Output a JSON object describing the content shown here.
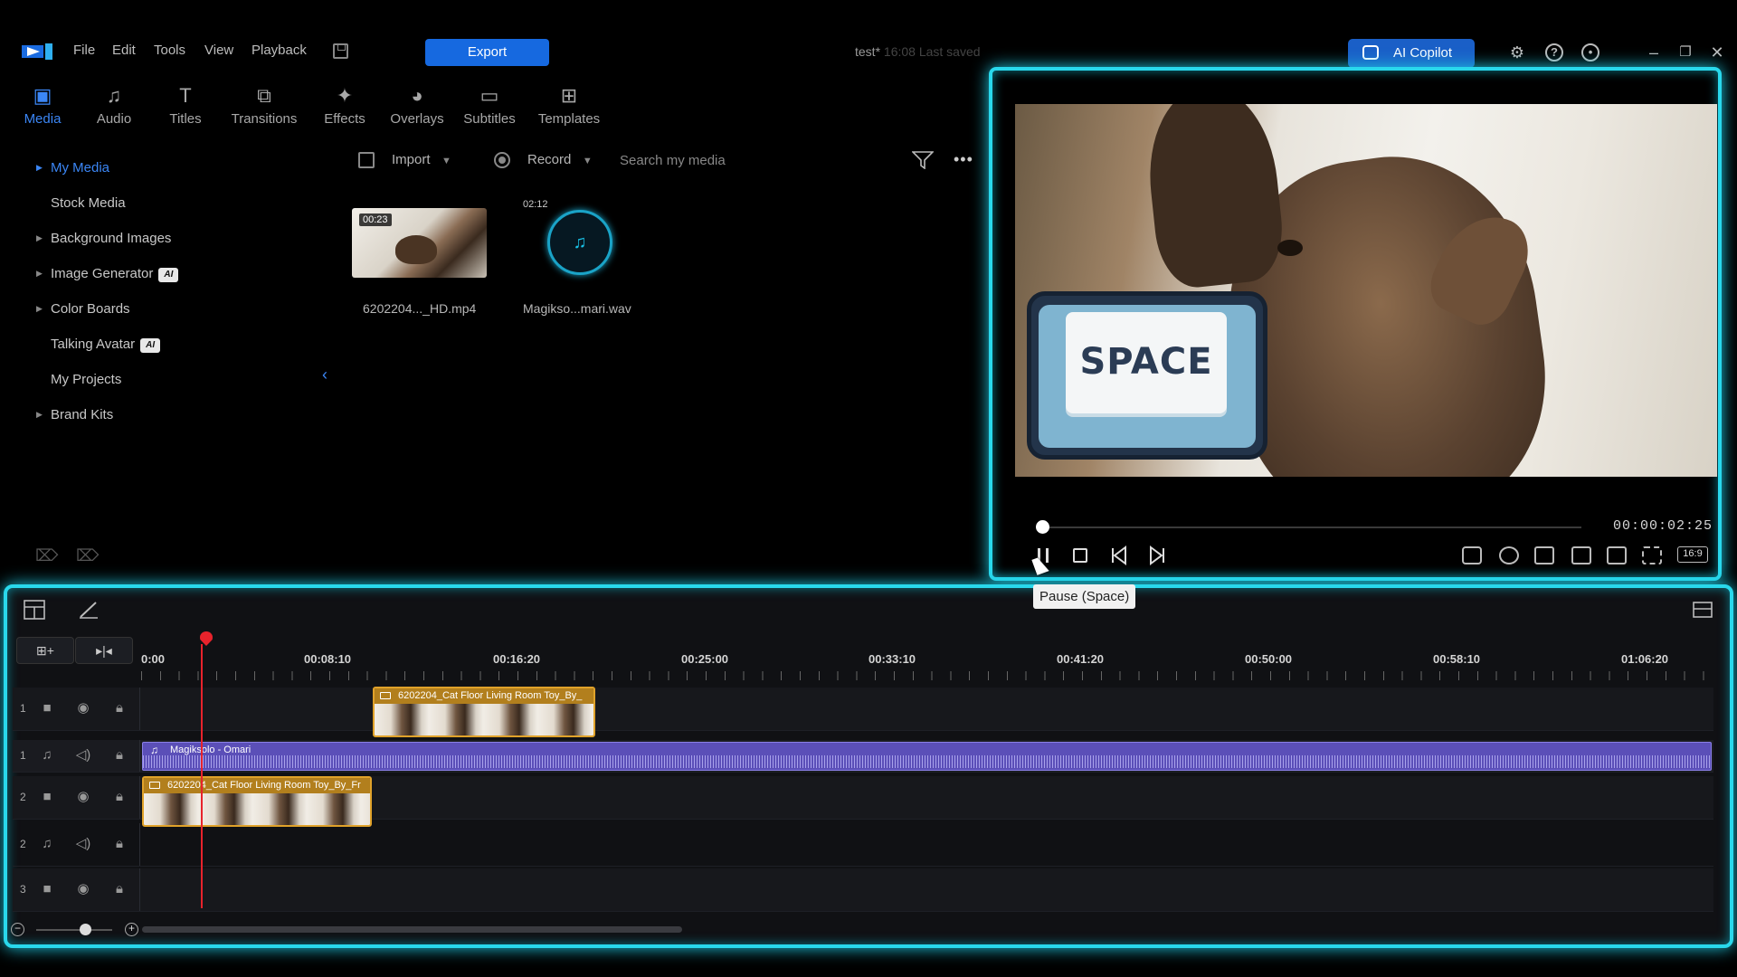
{
  "menu": {
    "items": [
      "File",
      "Edit",
      "Tools",
      "View",
      "Playback"
    ],
    "export_label": "Export",
    "doc_title": "test*",
    "doc_title_faded": " 16:08 Last saved",
    "copilot_label": "AI Copilot"
  },
  "tabs": [
    {
      "label": "Media",
      "icon": "media-icon",
      "active": true
    },
    {
      "label": "Audio",
      "icon": "music-note-icon"
    },
    {
      "label": "Titles",
      "icon": "text-icon"
    },
    {
      "label": "Transitions",
      "icon": "transition-icon"
    },
    {
      "label": "Effects",
      "icon": "effects-icon"
    },
    {
      "label": "Overlays",
      "icon": "overlays-icon"
    },
    {
      "label": "Subtitles",
      "icon": "subtitles-icon"
    },
    {
      "label": "Templates",
      "icon": "templates-icon"
    }
  ],
  "library": {
    "items": [
      {
        "label": "My Media",
        "expandable": true,
        "active": true
      },
      {
        "label": "Stock Media",
        "expandable": false
      },
      {
        "label": "Background Images",
        "expandable": true
      },
      {
        "label": "Image Generator",
        "expandable": true,
        "badge": "AI"
      },
      {
        "label": "Color Boards",
        "expandable": true
      },
      {
        "label": "Talking Avatar",
        "expandable": false,
        "badge": "AI"
      },
      {
        "label": "My Projects",
        "expandable": false
      },
      {
        "label": "Brand Kits",
        "expandable": true
      }
    ]
  },
  "media_toolbar": {
    "import_label": "Import",
    "record_label": "Record",
    "search_placeholder": "Search my media"
  },
  "media_items": [
    {
      "name": "6202204..._HD.mp4",
      "duration": "00:23",
      "type": "video"
    },
    {
      "name": "Magikso...mari.wav",
      "duration": "02:12",
      "type": "audio"
    }
  ],
  "preview": {
    "overlay_text": "SPACE",
    "timecode": "00:00:02:25",
    "progress": 0.01,
    "aspect_ratio": "16:9",
    "tooltip": "Pause (Space)"
  },
  "timeline": {
    "ruler_labels": [
      "0:00",
      "00:08:10",
      "00:16:20",
      "00:25:00",
      "00:33:10",
      "00:41:20",
      "00:50:00",
      "00:58:10",
      "01:06:20"
    ],
    "tracks": [
      {
        "number": "1",
        "kind": "video"
      },
      {
        "number": "1",
        "kind": "audio"
      },
      {
        "number": "2",
        "kind": "video"
      },
      {
        "number": "2",
        "kind": "audio"
      },
      {
        "number": "3",
        "kind": "video"
      }
    ],
    "clips": {
      "video_track1": "6202204_Cat Floor Living Room Toy_By_",
      "audio_track1": "Magiksolo - Omari",
      "video_track2": "6202204_Cat Floor Living Room Toy_By_Fr"
    }
  },
  "colors": {
    "accent": "#1669e0",
    "highlight": "#29d8ec",
    "playhead": "#e8232c",
    "video_clip": "#e0a22a",
    "audio_clip": "#5b4fb8"
  }
}
